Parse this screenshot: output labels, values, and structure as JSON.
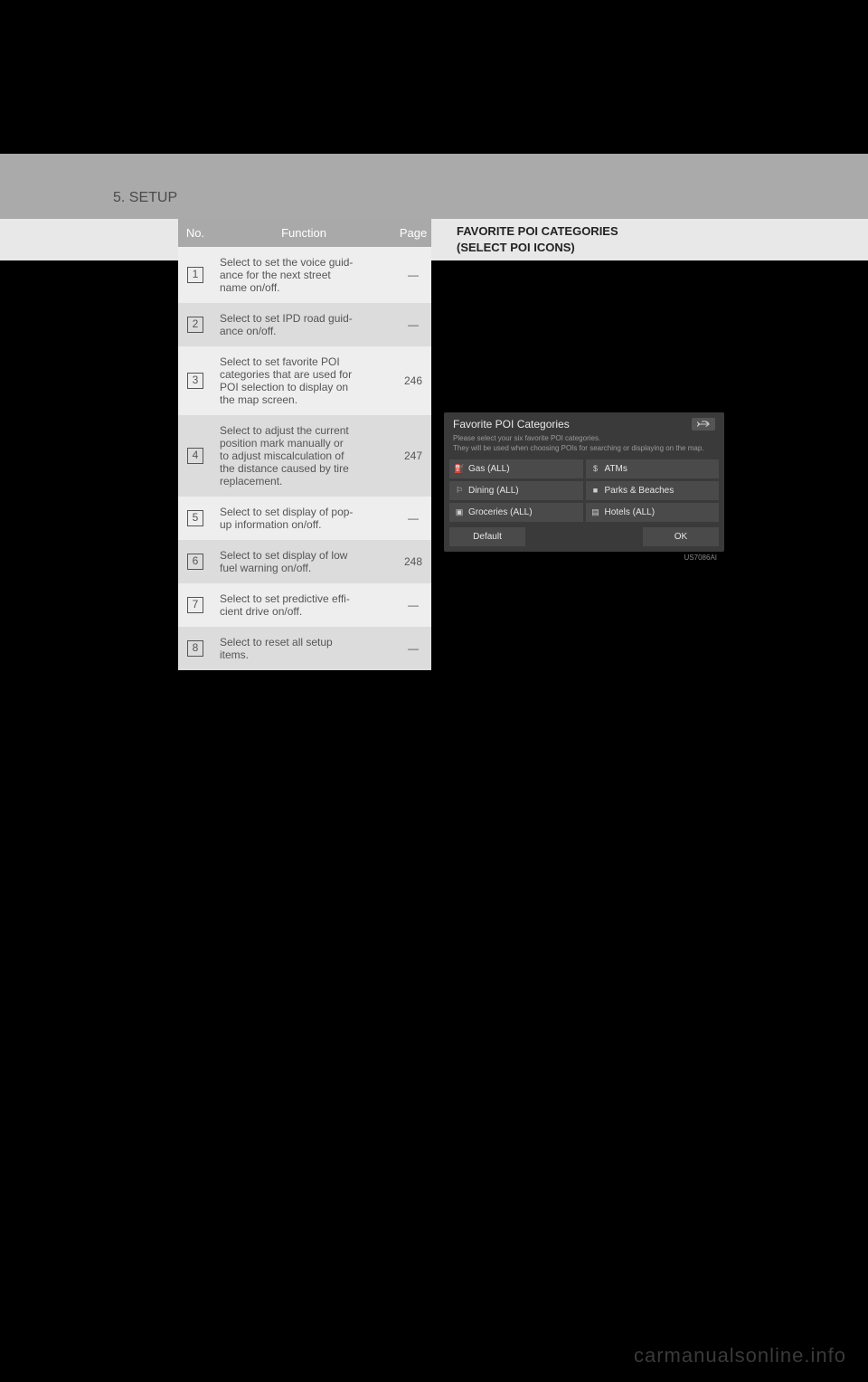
{
  "header": {
    "section_label": "5. SETUP"
  },
  "table": {
    "columns": {
      "no": "No.",
      "function": "Function",
      "page": "Page"
    },
    "rows": [
      {
        "num": "1",
        "function": "Select to set the voice guid-\nance for the next street\nname on/off.",
        "page": "—"
      },
      {
        "num": "2",
        "function": "Select to set IPD road guid-\nance on/off.",
        "page": "—"
      },
      {
        "num": "3",
        "function": "Select to set favorite POI\ncategories that are used for\nPOI selection to display on\nthe map screen.",
        "page": "246"
      },
      {
        "num": "4",
        "function": "Select to adjust the current\nposition mark manually or\nto adjust miscalculation of\nthe distance caused by tire\nreplacement.",
        "page": "247"
      },
      {
        "num": "5",
        "function": "Select to set display of pop-\nup information on/off.",
        "page": "—"
      },
      {
        "num": "6",
        "function": "Select to set display of low\nfuel warning on/off.",
        "page": "248"
      },
      {
        "num": "7",
        "function": "Select to set predictive effi-\ncient drive on/off.",
        "page": "—"
      },
      {
        "num": "8",
        "function": "Select to reset all setup\nitems.",
        "page": "—"
      }
    ]
  },
  "right": {
    "title_line1": "FAVORITE POI CATEGORIES",
    "title_line2": "(SELECT POI ICONS)"
  },
  "screenshot": {
    "title": "Favorite POI Categories",
    "desc_line1": "Please select your six favorite POI categories.",
    "desc_line2": "They will be used when choosing POIs for searching or displaying on the map.",
    "items": [
      {
        "icon": "gas-pump-icon",
        "label": "Gas (ALL)"
      },
      {
        "icon": "dollar-icon",
        "label": "ATMs"
      },
      {
        "icon": "fork-knife-icon",
        "label": "Dining (ALL)"
      },
      {
        "icon": "tree-icon",
        "label": "Parks & Beaches"
      },
      {
        "icon": "cart-icon",
        "label": "Groceries (ALL)"
      },
      {
        "icon": "bed-icon",
        "label": "Hotels (ALL)"
      }
    ],
    "default_label": "Default",
    "ok_label": "OK",
    "code": "US7086AI"
  },
  "watermark": "carmanualsonline.info",
  "icon_glyphs": {
    "gas-pump-icon": "⛽",
    "dollar-icon": "$",
    "fork-knife-icon": "⚐",
    "tree-icon": "■",
    "cart-icon": "▣",
    "bed-icon": "▤"
  }
}
